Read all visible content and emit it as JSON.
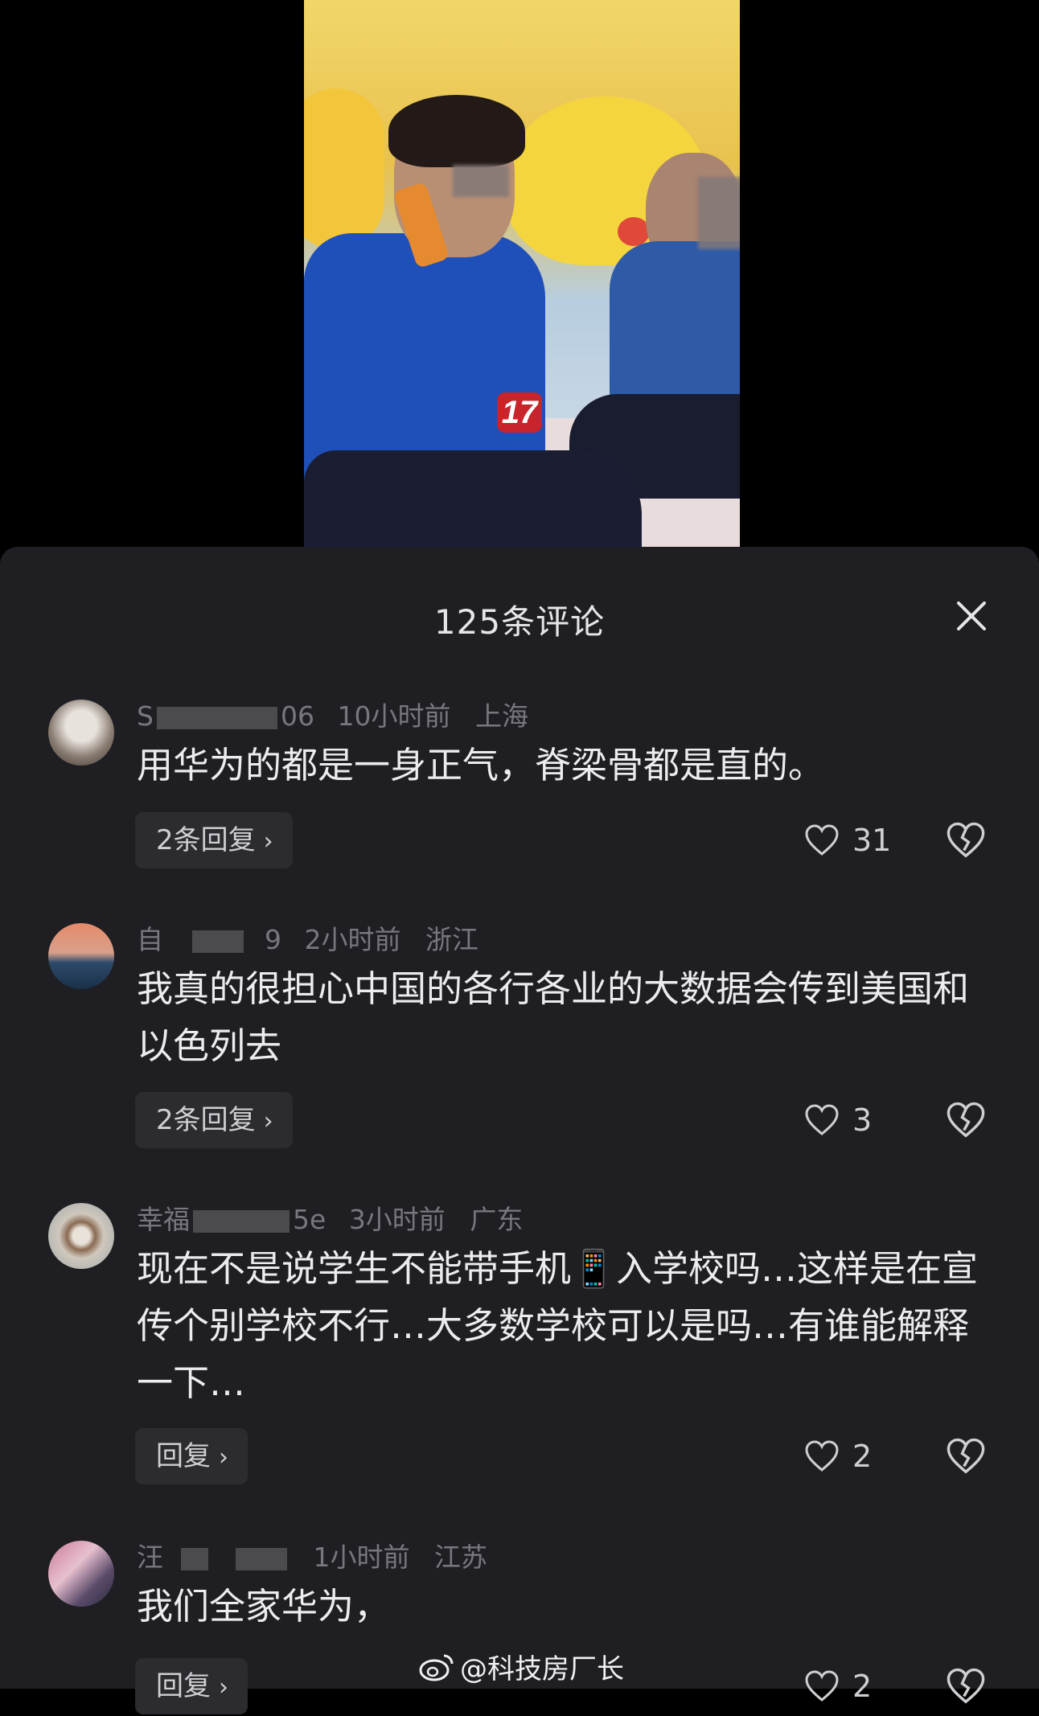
{
  "video": {
    "badge": "17"
  },
  "sheet": {
    "title": "125条评论"
  },
  "comments": [
    {
      "username_start": "S",
      "username_end": "06",
      "time": "10小时前",
      "location": "上海",
      "text": "用华为的都是一身正气，脊梁骨都是直的。",
      "replies": "2条回复",
      "likes": "31"
    },
    {
      "username_start": "自",
      "username_end": "9",
      "time": "2小时前",
      "location": "浙江",
      "text": "我真的很担心中国的各行各业的大数据会传到美国和以色列去",
      "replies": "2条回复",
      "likes": "3"
    },
    {
      "username_start": "幸福",
      "username_end": "5e",
      "time": "3小时前",
      "location": "广东",
      "text": "现在不是说学生不能带手机📱入学校吗…这样是在宣传个别学校不行…大多数学校可以是吗…有谁能解释一下…",
      "replies": "回复",
      "likes": "2"
    },
    {
      "username_start": "汪",
      "username_end": "",
      "time": "1小时前",
      "location": "江苏",
      "text": "我们全家华为，",
      "replies": "回复",
      "likes": "2"
    }
  ],
  "watermark": "@科技房厂长",
  "icons": {
    "close": "close-icon",
    "reply_chevron": "chevron-right-icon",
    "like": "heart-icon",
    "dislike": "broken-heart-icon",
    "weibo": "weibo-logo-icon"
  }
}
